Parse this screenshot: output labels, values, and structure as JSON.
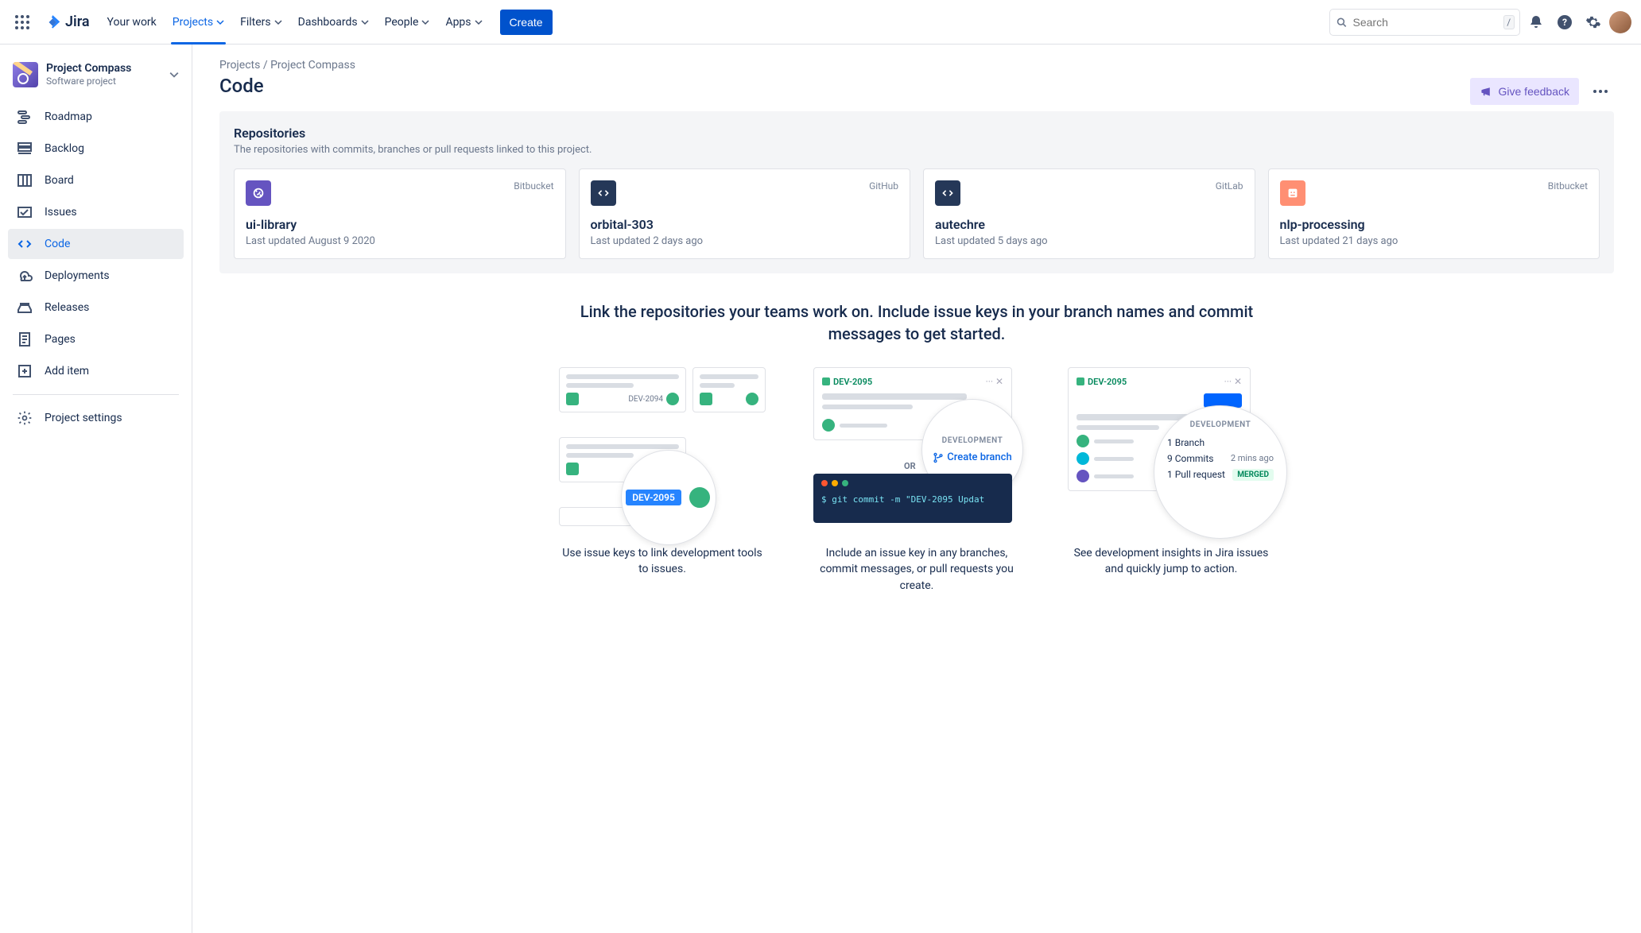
{
  "topnav": {
    "logo_text": "Jira",
    "items": [
      {
        "label": "Your work",
        "active": false,
        "chev": false
      },
      {
        "label": "Projects",
        "active": true,
        "chev": true
      },
      {
        "label": "Filters",
        "active": false,
        "chev": true
      },
      {
        "label": "Dashboards",
        "active": false,
        "chev": true
      },
      {
        "label": "People",
        "active": false,
        "chev": true
      },
      {
        "label": "Apps",
        "active": false,
        "chev": true
      }
    ],
    "create_label": "Create",
    "search_placeholder": "Search",
    "search_shortcut": "/"
  },
  "sidebar": {
    "project_name": "Project Compass",
    "project_type": "Software project",
    "items": [
      {
        "icon": "roadmap",
        "label": "Roadmap",
        "active": false
      },
      {
        "icon": "backlog",
        "label": "Backlog",
        "active": false
      },
      {
        "icon": "board",
        "label": "Board",
        "active": false
      },
      {
        "icon": "issues",
        "label": "Issues",
        "active": false
      },
      {
        "icon": "code",
        "label": "Code",
        "active": true
      },
      {
        "icon": "deployments",
        "label": "Deployments",
        "active": false
      },
      {
        "icon": "releases",
        "label": "Releases",
        "active": false
      },
      {
        "icon": "pages",
        "label": "Pages",
        "active": false
      },
      {
        "icon": "add",
        "label": "Add item",
        "active": false
      },
      {
        "icon": "settings",
        "label": "Project settings",
        "active": false
      }
    ]
  },
  "breadcrumb": {
    "root": "Projects",
    "sep": "/",
    "leaf": "Project Compass"
  },
  "page_title": "Code",
  "feedback_label": "Give feedback",
  "repos": {
    "title": "Repositories",
    "description": "The repositories with commits, branches or pull requests linked to this project.",
    "cards": [
      {
        "provider": "Bitbucket",
        "name": "ui-library",
        "updated": "Last updated August 9 2020",
        "icon": "bb"
      },
      {
        "provider": "GitHub",
        "name": "orbital-303",
        "updated": "Last updated 2 days ago",
        "icon": "gh"
      },
      {
        "provider": "GitLab",
        "name": "autechre",
        "updated": "Last updated 5 days ago",
        "icon": "gl"
      },
      {
        "provider": "Bitbucket",
        "name": "nlp-processing",
        "updated": "Last updated 21 days ago",
        "icon": "nlp"
      }
    ]
  },
  "hero": "Link the repositories your teams work on. Include issue keys in your branch names and commit messages to get started.",
  "steps": [
    {
      "caption": "Use issue keys to link development tools to issues.",
      "issue_key_small": "DEV-2094",
      "issue_key_big": "DEV-2095"
    },
    {
      "caption": "Include an issue key in any branches, commit messages, or pull requests you create.",
      "mock_key": "DEV-2095",
      "lens_label": "DEVELOPMENT",
      "lens_action": "Create branch",
      "or_label": "OR",
      "terminal": "$ git commit -m \"DEV-2095 Updat"
    },
    {
      "caption": "See development insights in Jira issues and quickly jump to action.",
      "mock_key": "DEV-2095",
      "lens_label": "DEVELOPMENT",
      "rows": [
        {
          "k": "1 Branch",
          "v": ""
        },
        {
          "k": "9 Commits",
          "v": "2 mins ago"
        },
        {
          "k": "1 Pull request",
          "v": "MERGED"
        }
      ]
    }
  ]
}
